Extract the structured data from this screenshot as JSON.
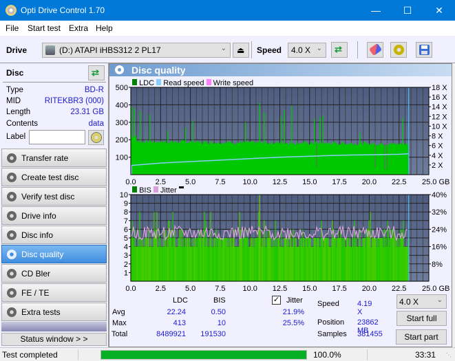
{
  "window": {
    "title": "Opti Drive Control 1.70",
    "minimize": "—",
    "maximize": "☐",
    "close": "✕"
  },
  "menu": [
    "File",
    "Start test",
    "Extra",
    "Help"
  ],
  "toolbar": {
    "drive_label": "Drive",
    "drive_value": "(D:)  ATAPI iHBS312  2 PL17",
    "speed_label": "Speed",
    "speed_value": "4.0 X"
  },
  "disc": {
    "header": "Disc",
    "fields": [
      {
        "key": "Type",
        "value": "BD-R"
      },
      {
        "key": "MID",
        "value": "RITEKBR3 (000)"
      },
      {
        "key": "Length",
        "value": "23.31 GB"
      },
      {
        "key": "Contents",
        "value": "data"
      }
    ],
    "label_key": "Label",
    "label_value": ""
  },
  "nav": [
    {
      "label": "Transfer rate",
      "active": false
    },
    {
      "label": "Create test disc",
      "active": false
    },
    {
      "label": "Verify test disc",
      "active": false
    },
    {
      "label": "Drive info",
      "active": false
    },
    {
      "label": "Disc info",
      "active": false
    },
    {
      "label": "Disc quality",
      "active": true
    },
    {
      "label": "CD Bler",
      "active": false
    },
    {
      "label": "FE / TE",
      "active": false
    },
    {
      "label": "Extra tests",
      "active": false
    }
  ],
  "status_window_button": "Status window > >",
  "panel_title": "Disc quality",
  "chart_data": [
    {
      "type": "bar",
      "title": "LDC",
      "legend": [
        {
          "name": "LDC",
          "color": "#008000"
        },
        {
          "name": "Read speed",
          "color": "#87cefa"
        },
        {
          "name": "Write speed",
          "color": "#ff80ff"
        }
      ],
      "xlabel": "GB",
      "x_ticks": [
        "0.0",
        "2.5",
        "5.0",
        "7.5",
        "10.0",
        "12.5",
        "15.0",
        "17.5",
        "20.0",
        "22.5",
        "25.0 GB"
      ],
      "xlim": [
        0,
        25
      ],
      "y_ticks": [
        "100",
        "200",
        "300",
        "400",
        "500"
      ],
      "ylim": [
        0,
        500
      ],
      "y2_ticks": [
        "2 X",
        "4 X",
        "6 X",
        "8 X",
        "10 X",
        "12 X",
        "14 X",
        "16 X",
        "18 X"
      ],
      "y2lim": [
        0,
        18
      ],
      "ldc_baseline": 190,
      "ldc_spikes": [
        [
          0.1,
          390
        ],
        [
          0.3,
          380
        ],
        [
          0.8,
          365
        ],
        [
          1.6,
          345
        ],
        [
          3.1,
          250
        ],
        [
          4.6,
          270
        ],
        [
          5.2,
          310
        ],
        [
          9.6,
          300
        ],
        [
          10.8,
          410
        ],
        [
          11.2,
          360
        ],
        [
          12.6,
          335
        ],
        [
          12.9,
          370
        ],
        [
          13.5,
          395
        ],
        [
          15.4,
          320
        ],
        [
          15.9,
          330
        ],
        [
          16.1,
          340
        ],
        [
          19.2,
          240
        ],
        [
          22.8,
          325
        ]
      ],
      "ldc_dips": [
        [
          15.6,
          40
        ],
        [
          20.5,
          40
        ],
        [
          21.3,
          30
        ],
        [
          21.5,
          30
        ]
      ],
      "end_gb": 23.31,
      "read_speed": [
        [
          0.0,
          1.9
        ],
        [
          2.5,
          2.4
        ],
        [
          5.0,
          2.7
        ],
        [
          7.5,
          3.0
        ],
        [
          10.0,
          3.3
        ],
        [
          12.5,
          3.6
        ],
        [
          15.0,
          3.8
        ],
        [
          17.5,
          4.0
        ],
        [
          20.0,
          4.1
        ],
        [
          22.5,
          4.2
        ],
        [
          23.3,
          4.3
        ]
      ]
    },
    {
      "type": "bar",
      "title": "BIS",
      "legend": [
        {
          "name": "BIS",
          "color": "#008000"
        },
        {
          "name": "Jitter",
          "color": "#d8a0d8"
        }
      ],
      "xlabel": "GB",
      "x_ticks": [
        "0.0",
        "2.5",
        "5.0",
        "7.5",
        "10.0",
        "12.5",
        "15.0",
        "17.5",
        "20.0",
        "22.5",
        "25.0 GB"
      ],
      "xlim": [
        0,
        25
      ],
      "y_ticks": [
        "1",
        "2",
        "3",
        "4",
        "5",
        "6",
        "7",
        "8",
        "9",
        "10"
      ],
      "ylim": [
        0,
        10
      ],
      "y2_ticks": [
        "8%",
        "16%",
        "24%",
        "32%",
        "40%"
      ],
      "y2lim": [
        0,
        40
      ],
      "bis_typical_max": 6,
      "bis_max": 10,
      "jitter_range_pct": [
        19,
        25.5
      ],
      "end_gb": 23.31
    }
  ],
  "stats": {
    "col_ldc": "LDC",
    "col_bis": "BIS",
    "jitter_checked": true,
    "jitter_label": "Jitter",
    "rows": [
      {
        "label": "Avg",
        "ldc": "22.24",
        "bis": "0.50",
        "jitter": "21.9%"
      },
      {
        "label": "Max",
        "ldc": "413",
        "bis": "10",
        "jitter": "25.5%"
      },
      {
        "label": "Total",
        "ldc": "8489921",
        "bis": "191530",
        "jitter": ""
      }
    ],
    "speed_label": "Speed",
    "speed_value": "4.19 X",
    "position_label": "Position",
    "position_value": "23862 MB",
    "samples_label": "Samples",
    "samples_value": "381455",
    "speed_select": "4.0 X",
    "start_full": "Start full",
    "start_part": "Start part"
  },
  "statusbar": {
    "text": "Test completed",
    "progress": 1.0,
    "progress_text": "100.0%",
    "time": "33:31"
  }
}
